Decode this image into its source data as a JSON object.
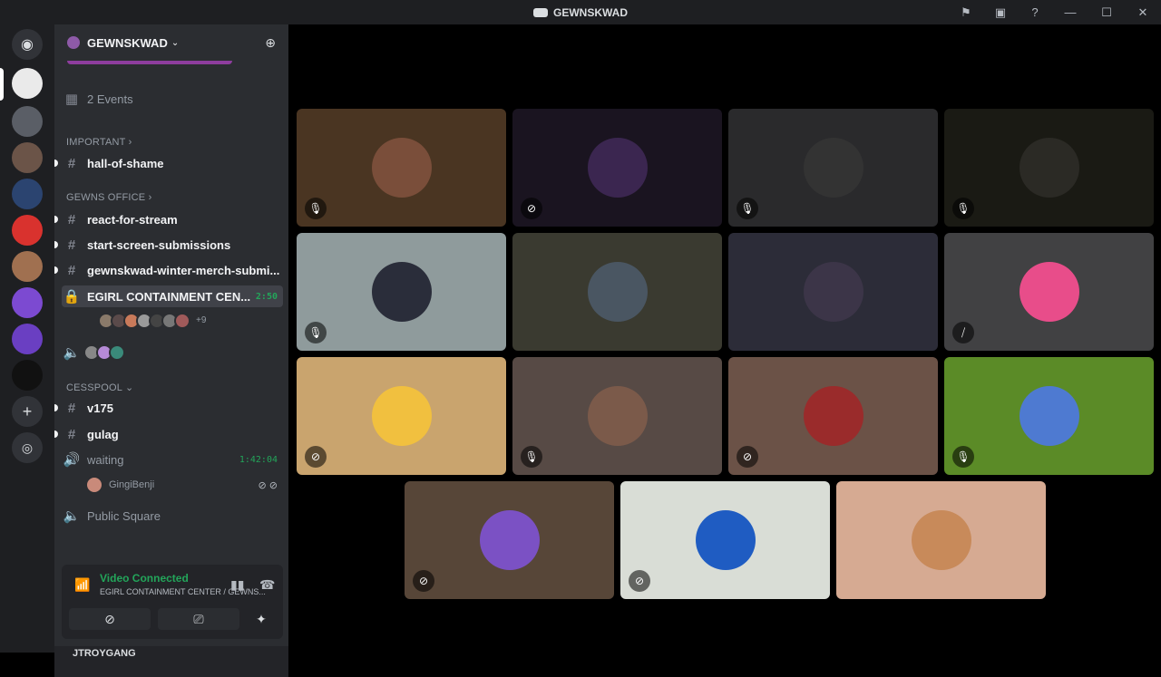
{
  "window": {
    "title": "GEWNSKWAD"
  },
  "server": {
    "name": "GEWNSKWAD",
    "events_label": "2 Events"
  },
  "categories": {
    "important": "IMPORTANT ›",
    "office": "GEWNS OFFICE ›",
    "cesspool": "CESSPOOL ⌄"
  },
  "channels": {
    "hall_of_shame": "hall-of-shame",
    "react_for_stream": "react-for-stream",
    "start_screen": "start-screen-submissions",
    "winter_merch": "gewnskwad-winter-merch-submi...",
    "egirl": "EGIRL CONTAINMENT CEN...",
    "egirl_timer": "2:50",
    "egirl_more": "+9",
    "v175": "v175",
    "gulag": "gulag",
    "waiting": "waiting",
    "waiting_timer": "1:42:04",
    "waiting_member": "GingiBenji",
    "public_square": "Public Square"
  },
  "voice_panel": {
    "status": "Video Connected",
    "location": "EGIRL CONTAINMENT CENTER / GEWNS..."
  },
  "user": {
    "name": "JTROYGANG"
  },
  "colors": {
    "connected_green": "#23a55a",
    "tile_colors": [
      "#4a3522",
      "#1a1420",
      "#2a2a2c",
      "#1a1a14",
      "#8f9b9c",
      "#3a3a30",
      "#2c2c38",
      "#414143",
      "#c9a46e",
      "#574a45",
      "#6b5247",
      "#5b8b27",
      "#574638",
      "#d9ddd6",
      "#d6aa92"
    ]
  },
  "tiles": [
    {
      "avatar_color": "#7a4e3a",
      "mic": "mic-off"
    },
    {
      "avatar_color": "#3b2650",
      "mic": "video-off"
    },
    {
      "avatar_color": "#333",
      "mic": "mic-off"
    },
    {
      "avatar_color": "#2b2a25",
      "mic": "mic-off"
    },
    {
      "avatar_color": "#2a2d3a",
      "mic": "mic-off"
    },
    {
      "avatar_color": "#4a5662",
      "mic": "none"
    },
    {
      "avatar_color": "#3c3548",
      "mic": "none"
    },
    {
      "avatar_color": "#e84d8a",
      "mic": "mic-slash"
    },
    {
      "avatar_color": "#f1c03f",
      "mic": "video-off"
    },
    {
      "avatar_color": "#7b5a4a",
      "mic": "mic-off"
    },
    {
      "avatar_color": "#9a2b2b",
      "mic": "video-off"
    },
    {
      "avatar_color": "#4e7ad1",
      "mic": "mic-off"
    },
    {
      "avatar_color": "#7b51c4",
      "mic": "video-off"
    },
    {
      "avatar_color": "#1f5cc2",
      "mic": "video-off"
    },
    {
      "avatar_color": "#c88a5a",
      "mic": "none"
    }
  ]
}
